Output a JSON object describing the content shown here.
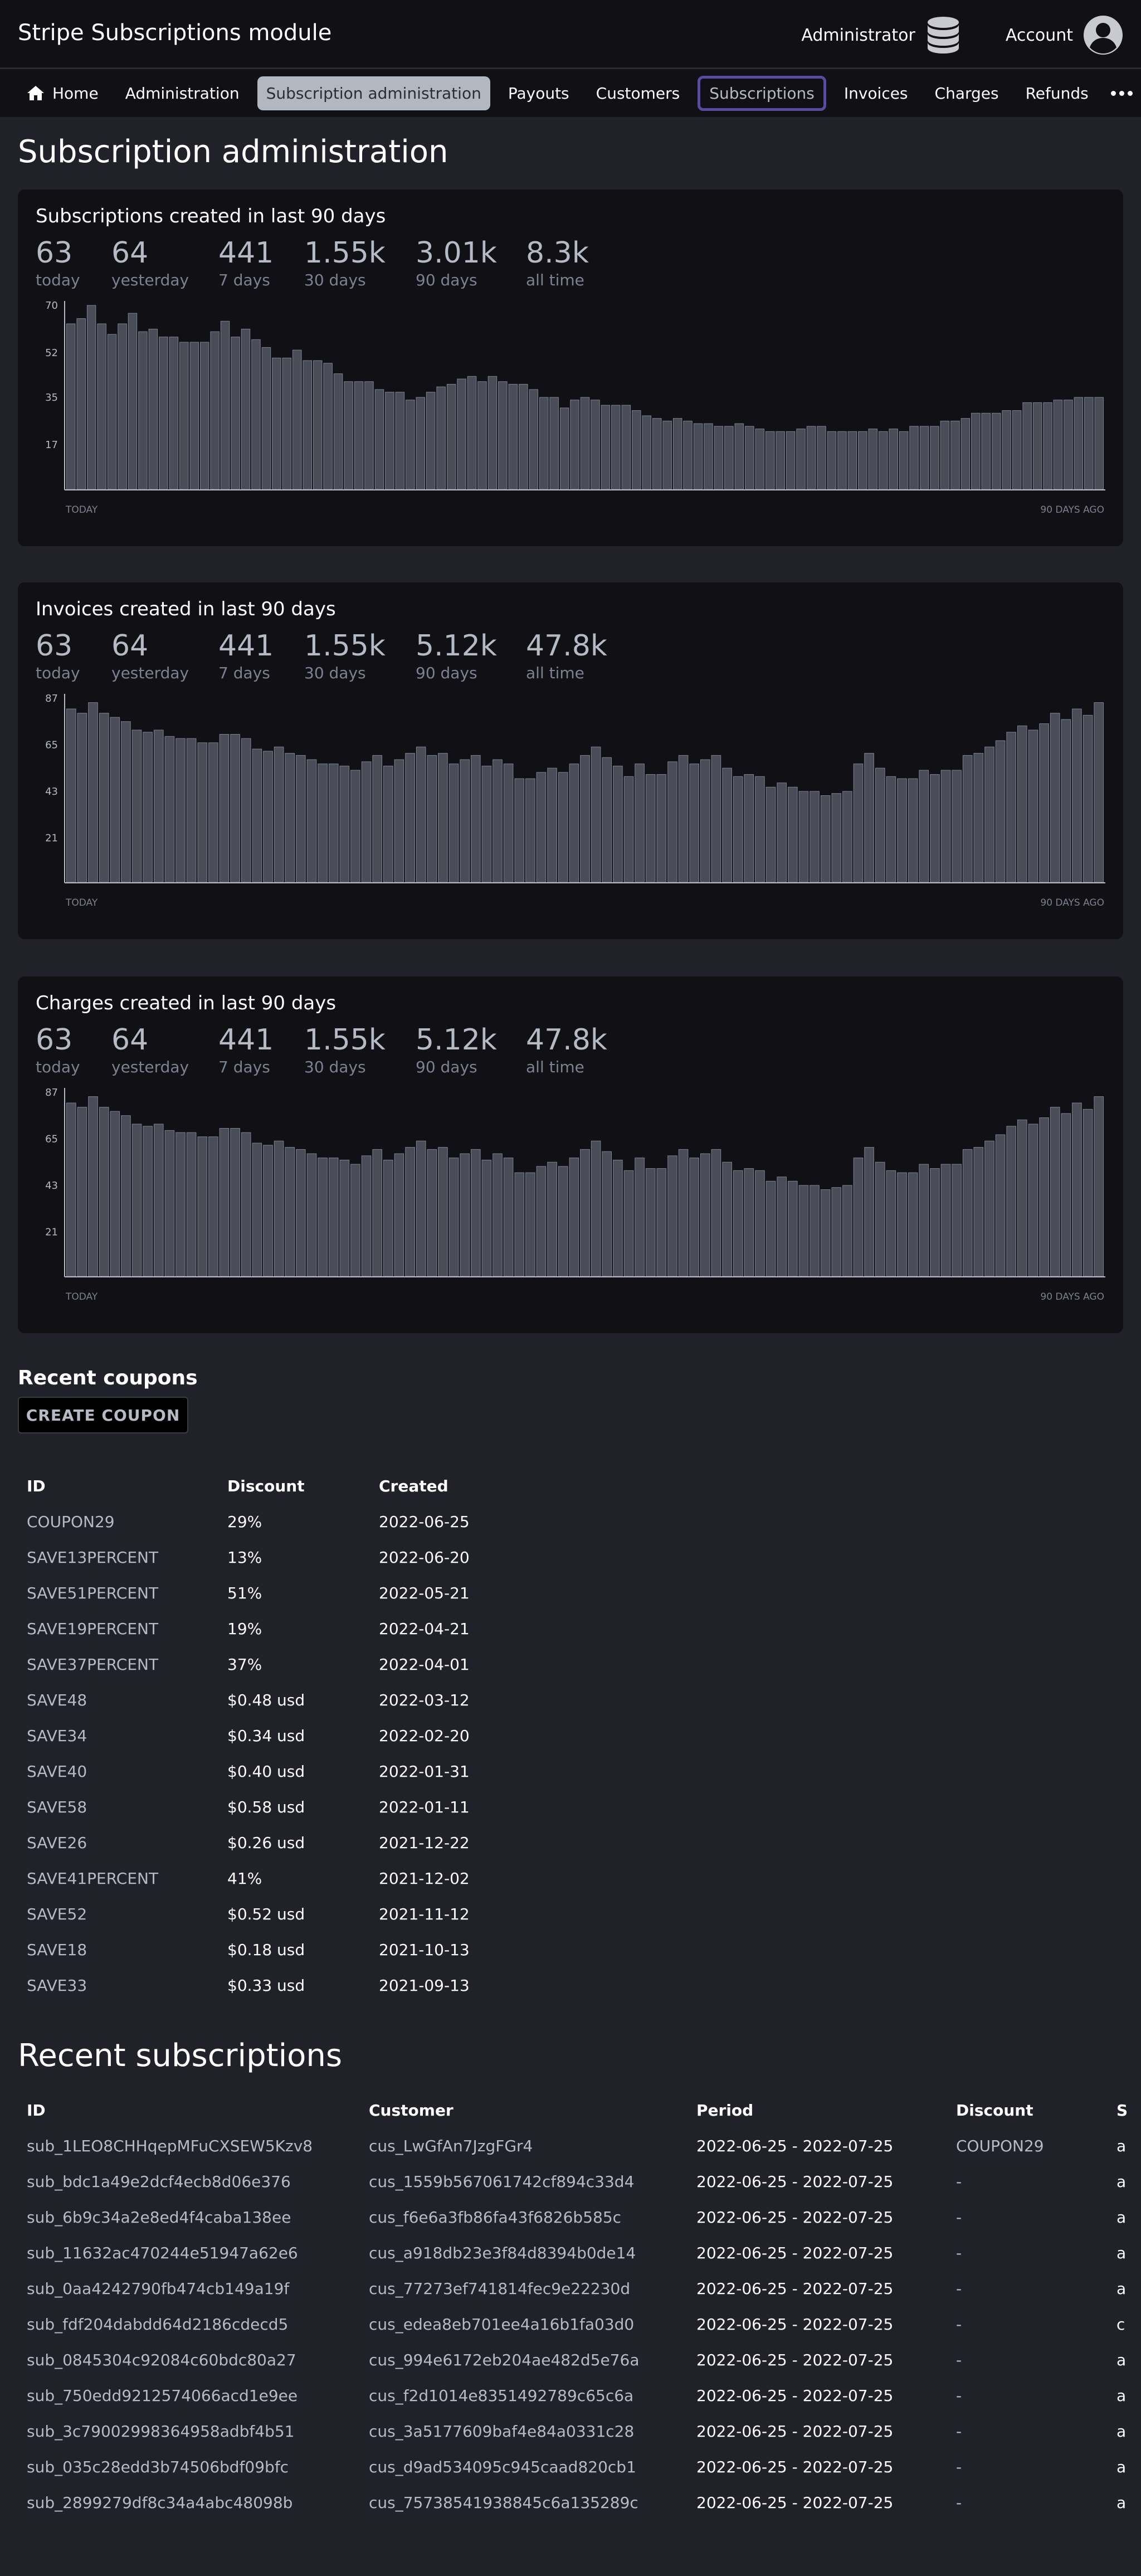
{
  "app_title": "Stripe Subscriptions module",
  "header": {
    "admin_label": "Administrator",
    "account_label": "Account"
  },
  "nav": {
    "items": [
      "Home",
      "Administration",
      "Subscription administration",
      "Payouts",
      "Customers",
      "Subscriptions",
      "Invoices",
      "Charges",
      "Refunds"
    ]
  },
  "page_title": "Subscription administration",
  "panels": [
    {
      "title": "Subscriptions created in last 90 days",
      "stats": [
        {
          "value": "63",
          "label": "today"
        },
        {
          "value": "64",
          "label": "yesterday"
        },
        {
          "value": "441",
          "label": "7 days"
        },
        {
          "value": "1.55k",
          "label": "30 days"
        },
        {
          "value": "3.01k",
          "label": "90 days"
        },
        {
          "value": "8.3k",
          "label": "all time"
        }
      ]
    },
    {
      "title": "Invoices created in last 90 days",
      "stats": [
        {
          "value": "63",
          "label": "today"
        },
        {
          "value": "64",
          "label": "yesterday"
        },
        {
          "value": "441",
          "label": "7 days"
        },
        {
          "value": "1.55k",
          "label": "30 days"
        },
        {
          "value": "5.12k",
          "label": "90 days"
        },
        {
          "value": "47.8k",
          "label": "all time"
        }
      ]
    },
    {
      "title": "Charges created in last 90 days",
      "stats": [
        {
          "value": "63",
          "label": "today"
        },
        {
          "value": "64",
          "label": "yesterday"
        },
        {
          "value": "441",
          "label": "7 days"
        },
        {
          "value": "1.55k",
          "label": "30 days"
        },
        {
          "value": "5.12k",
          "label": "90 days"
        },
        {
          "value": "47.8k",
          "label": "all time"
        }
      ]
    }
  ],
  "chart_data": [
    {
      "type": "bar",
      "ylim": [
        0,
        70
      ],
      "yticks": [
        "70",
        "52",
        "35",
        "17"
      ],
      "x_start_label": "TODAY",
      "x_end_label": "90 DAYS AGO",
      "values": [
        63,
        65,
        70,
        63,
        59,
        63,
        67,
        60,
        61,
        58,
        58,
        56,
        56,
        56,
        60,
        64,
        58,
        61,
        57,
        54,
        50,
        50,
        53,
        49,
        49,
        48,
        44,
        41,
        41,
        41,
        38,
        37,
        37,
        34,
        35,
        37,
        39,
        40,
        42,
        43,
        41,
        43,
        41,
        40,
        40,
        38,
        35,
        35,
        31,
        34,
        35,
        34,
        32,
        32,
        32,
        30,
        28,
        27,
        26,
        27,
        26,
        25,
        25,
        24,
        24,
        25,
        24,
        23,
        22,
        22,
        22,
        23,
        24,
        24,
        22,
        22,
        22,
        22,
        23,
        22,
        23,
        22,
        24,
        24,
        24,
        26,
        26,
        27,
        29,
        29,
        29,
        30,
        30,
        33,
        33,
        33,
        34,
        34,
        35,
        35,
        35
      ]
    },
    {
      "type": "bar",
      "ylim": [
        0,
        87
      ],
      "yticks": [
        "87",
        "65",
        "43",
        "21"
      ],
      "x_start_label": "TODAY",
      "x_end_label": "90 DAYS AGO",
      "values": [
        82,
        80,
        85,
        80,
        78,
        76,
        72,
        71,
        72,
        69,
        68,
        68,
        66,
        66,
        70,
        70,
        68,
        63,
        62,
        64,
        61,
        60,
        58,
        56,
        56,
        55,
        53,
        57,
        60,
        55,
        58,
        61,
        64,
        60,
        61,
        56,
        58,
        60,
        55,
        58,
        56,
        49,
        49,
        52,
        54,
        52,
        56,
        60,
        64,
        59,
        55,
        50,
        56,
        51,
        51,
        57,
        60,
        56,
        58,
        60,
        54,
        50,
        51,
        50,
        45,
        47,
        45,
        43,
        43,
        41,
        42,
        43,
        56,
        61,
        54,
        50,
        49,
        49,
        53,
        51,
        53,
        53,
        60,
        61,
        64,
        67,
        71,
        74,
        72,
        75,
        80,
        77,
        82,
        79,
        85
      ]
    },
    {
      "type": "bar",
      "ylim": [
        0,
        87
      ],
      "yticks": [
        "87",
        "65",
        "43",
        "21"
      ],
      "x_start_label": "TODAY",
      "x_end_label": "90 DAYS AGO",
      "values": [
        82,
        80,
        85,
        80,
        78,
        76,
        72,
        71,
        72,
        69,
        68,
        68,
        66,
        66,
        70,
        70,
        68,
        63,
        62,
        64,
        61,
        60,
        58,
        56,
        56,
        55,
        53,
        57,
        60,
        55,
        58,
        61,
        64,
        60,
        61,
        56,
        58,
        60,
        55,
        58,
        56,
        49,
        49,
        52,
        54,
        52,
        56,
        60,
        64,
        59,
        55,
        50,
        56,
        51,
        51,
        57,
        60,
        56,
        58,
        60,
        54,
        50,
        51,
        50,
        45,
        47,
        45,
        43,
        43,
        41,
        42,
        43,
        56,
        61,
        54,
        50,
        49,
        49,
        53,
        51,
        53,
        53,
        60,
        61,
        64,
        67,
        71,
        74,
        72,
        75,
        80,
        77,
        82,
        79,
        85
      ]
    }
  ],
  "coupons": {
    "title": "Recent coupons",
    "create_label": "CREATE COUPON",
    "headers": [
      "ID",
      "Discount",
      "Created"
    ],
    "rows": [
      [
        "COUPON29",
        "29%",
        "2022-06-25"
      ],
      [
        "SAVE13PERCENT",
        "13%",
        "2022-06-20"
      ],
      [
        "SAVE51PERCENT",
        "51%",
        "2022-05-21"
      ],
      [
        "SAVE19PERCENT",
        "19%",
        "2022-04-21"
      ],
      [
        "SAVE37PERCENT",
        "37%",
        "2022-04-01"
      ],
      [
        "SAVE48",
        "$0.48 usd",
        "2022-03-12"
      ],
      [
        "SAVE34",
        "$0.34 usd",
        "2022-02-20"
      ],
      [
        "SAVE40",
        "$0.40 usd",
        "2022-01-31"
      ],
      [
        "SAVE58",
        "$0.58 usd",
        "2022-01-11"
      ],
      [
        "SAVE26",
        "$0.26 usd",
        "2021-12-22"
      ],
      [
        "SAVE41PERCENT",
        "41%",
        "2021-12-02"
      ],
      [
        "SAVE52",
        "$0.52 usd",
        "2021-11-12"
      ],
      [
        "SAVE18",
        "$0.18 usd",
        "2021-10-13"
      ],
      [
        "SAVE33",
        "$0.33 usd",
        "2021-09-13"
      ]
    ]
  },
  "subscriptions": {
    "title": "Recent subscriptions",
    "headers": [
      "ID",
      "Customer",
      "Period",
      "Discount",
      "S"
    ],
    "rows": [
      [
        "sub_1LEO8CHHqepMFuCXSEW5Kzv8",
        "cus_LwGfAn7JzgFGr4",
        "2022-06-25 - 2022-07-25",
        "COUPON29",
        "a"
      ],
      [
        "sub_bdc1a49e2dcf4ecb8d06e376",
        "cus_1559b567061742cf894c33d4",
        "2022-06-25 - 2022-07-25",
        "-",
        "a"
      ],
      [
        "sub_6b9c34a2e8ed4f4caba138ee",
        "cus_f6e6a3fb86fa43f6826b585c",
        "2022-06-25 - 2022-07-25",
        "-",
        "a"
      ],
      [
        "sub_11632ac470244e51947a62e6",
        "cus_a918db23e3f84d8394b0de14",
        "2022-06-25 - 2022-07-25",
        "-",
        "a"
      ],
      [
        "sub_0aa4242790fb474cb149a19f",
        "cus_77273ef741814fec9e22230d",
        "2022-06-25 - 2022-07-25",
        "-",
        "a"
      ],
      [
        "sub_fdf204dabdd64d2186cdecd5",
        "cus_edea8eb701ee4a16b1fa03d0",
        "2022-06-25 - 2022-07-25",
        "-",
        "c"
      ],
      [
        "sub_0845304c92084c60bdc80a27",
        "cus_994e6172eb204ae482d5e76a",
        "2022-06-25 - 2022-07-25",
        "-",
        "a"
      ],
      [
        "sub_750edd9212574066acd1e9ee",
        "cus_f2d1014e8351492789c65c6a",
        "2022-06-25 - 2022-07-25",
        "-",
        "a"
      ],
      [
        "sub_3c79002998364958adbf4b51",
        "cus_3a5177609baf4e84a0331c28",
        "2022-06-25 - 2022-07-25",
        "-",
        "a"
      ],
      [
        "sub_035c28edd3b74506bdf09bfc",
        "cus_d9ad534095c945caad820cb1",
        "2022-06-25 - 2022-07-25",
        "-",
        "a"
      ],
      [
        "sub_2899279df8c34a4abc48098b",
        "cus_75738541938845c6a135289c",
        "2022-06-25 - 2022-07-25",
        "-",
        "a"
      ]
    ]
  },
  "colors": {
    "bar_fill": "#4a4d57",
    "bar_stroke": "#7c8190",
    "panel_bg": "#101015",
    "page_bg": "#212229",
    "accent_outline": "#5a4aa0"
  }
}
